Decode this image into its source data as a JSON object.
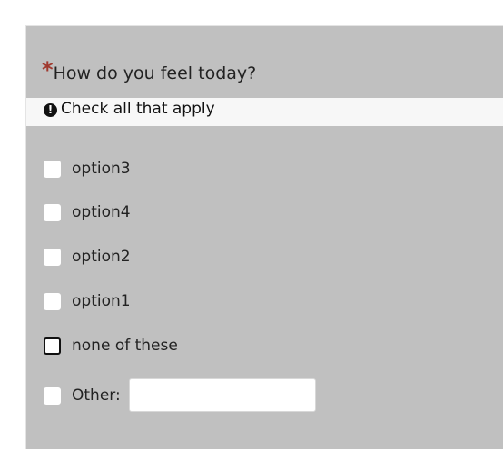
{
  "question": {
    "required_marker": "*",
    "text": "How do you feel today?"
  },
  "hint": {
    "icon": "exclamation-circle-icon",
    "text": "Check all that apply"
  },
  "options": [
    {
      "label": "option3",
      "checked": false
    },
    {
      "label": "option4",
      "checked": false
    },
    {
      "label": "option2",
      "checked": false
    },
    {
      "label": "option1",
      "checked": false
    },
    {
      "label": "none of these",
      "checked": false,
      "focused": true
    },
    {
      "label": "Other:",
      "checked": false
    }
  ],
  "other_input": {
    "value": ""
  },
  "colors": {
    "panel_background": "#c0c0c0",
    "hint_background": "#f7f7f7",
    "required_marker": "#a0392e"
  }
}
